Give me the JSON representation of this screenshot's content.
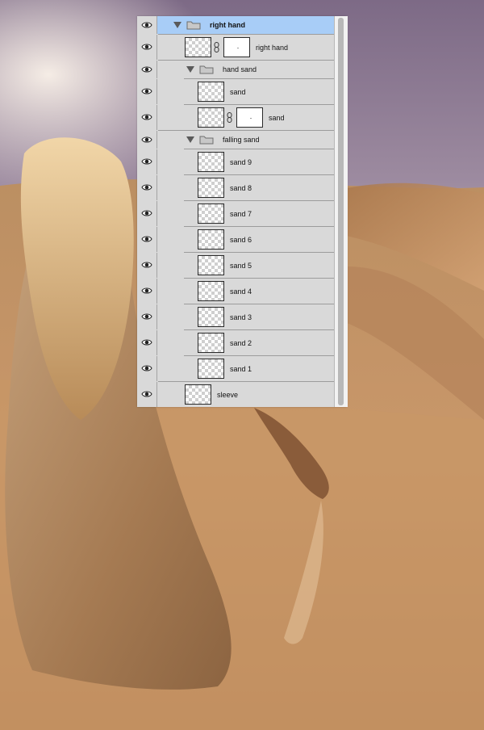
{
  "layers_panel": {
    "layers": [
      {
        "id": "right-hand-group",
        "label": "right hand",
        "type": "group",
        "selected": true,
        "expanded": true
      },
      {
        "id": "right-hand",
        "label": "right hand",
        "type": "layer",
        "has_mask": true
      },
      {
        "id": "hand-sand-group",
        "label": "hand sand",
        "type": "group",
        "expanded": true
      },
      {
        "id": "sand-a",
        "label": "sand",
        "type": "layer"
      },
      {
        "id": "sand-b",
        "label": "sand",
        "type": "layer",
        "has_mask": true
      },
      {
        "id": "falling-sand-group",
        "label": "falling sand",
        "type": "group",
        "expanded": true
      },
      {
        "id": "sand-9",
        "label": "sand 9",
        "type": "layer"
      },
      {
        "id": "sand-8",
        "label": "sand 8",
        "type": "layer"
      },
      {
        "id": "sand-7",
        "label": "sand 7",
        "type": "layer"
      },
      {
        "id": "sand-6",
        "label": "sand 6",
        "type": "layer"
      },
      {
        "id": "sand-5",
        "label": "sand 5",
        "type": "layer"
      },
      {
        "id": "sand-4",
        "label": "sand 4",
        "type": "layer"
      },
      {
        "id": "sand-3",
        "label": "sand 3",
        "type": "layer"
      },
      {
        "id": "sand-2",
        "label": "sand 2",
        "type": "layer"
      },
      {
        "id": "sand-1",
        "label": "sand 1",
        "type": "layer"
      },
      {
        "id": "sleeve",
        "label": "sleeve",
        "type": "layer"
      }
    ],
    "icons": {
      "visibility": "eye-icon",
      "expand": "triangle-down-icon",
      "group": "folder-icon",
      "link": "chain-link-icon"
    },
    "colors": {
      "panel_bg": "#d9d9d9",
      "selected_row": "#a8cdf7"
    }
  }
}
